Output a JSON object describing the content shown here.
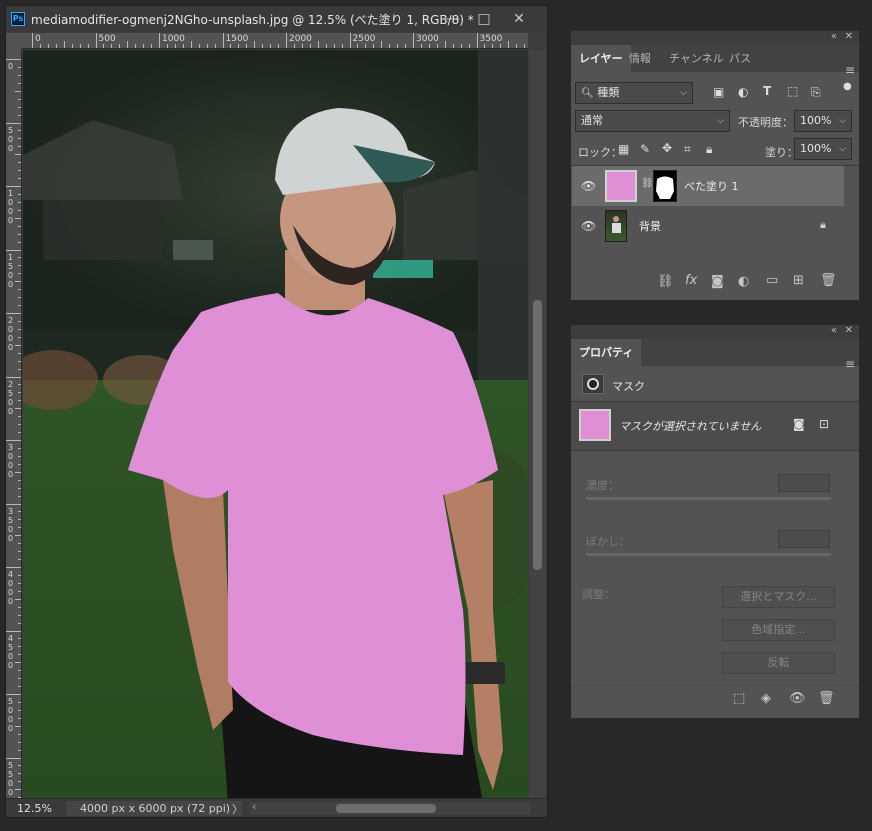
{
  "document": {
    "title": "mediamodifier-ogmenj2NGho-unsplash.jpg @ 12.5% (べた塗り 1, RGB/8) *",
    "app_icon": "Ps",
    "window_controls": {
      "minimize": "—",
      "maximize": "□",
      "close": "✕"
    },
    "ruler_top_labels": [
      "0",
      "500",
      "1000",
      "1500",
      "2000",
      "2500",
      "3000",
      "3500"
    ],
    "ruler_left_labels": [
      "0",
      "500",
      "1000",
      "1500",
      "2000",
      "2500",
      "3000",
      "3500",
      "4000",
      "4500",
      "5000",
      "5500"
    ],
    "zoom": "12.5%",
    "doc_size": "4000 px x 6000 px (72 ppi)",
    "status_arrow": "〉",
    "scroll_left": "‹",
    "fill_color": "#df8fd6"
  },
  "layers_panel": {
    "collapse_glyph": "«",
    "close_glyph": "✕",
    "tabs": [
      "レイヤー",
      "情報",
      "チャンネル",
      "パス"
    ],
    "active_tab": 0,
    "menu_icon": "hamburger-icon",
    "filter_kind": "種類",
    "blend_mode": "通常",
    "opacity_label": "不透明度：",
    "opacity": "100%",
    "lock_label": "ロック：",
    "fill_label": "塗り：",
    "fill": "100%",
    "layers": [
      {
        "name": "べた塗り 1",
        "visible": true,
        "selected": true,
        "thumb_color": "#df8fd6"
      },
      {
        "name": "背景",
        "visible": true,
        "selected": false,
        "locked": true
      }
    ]
  },
  "properties_panel": {
    "collapse_glyph": "«",
    "close_glyph": "✕",
    "tab": "プロパティ",
    "section": "マスク",
    "mask_status": "マスクが選択されていません",
    "density_label": "濃度：",
    "feather_label": "ぼかし：",
    "adjust_label": "調整：",
    "buttons": [
      "選択とマスク...",
      "色域指定...",
      "反転"
    ],
    "swatch_color": "#df8fd6"
  }
}
